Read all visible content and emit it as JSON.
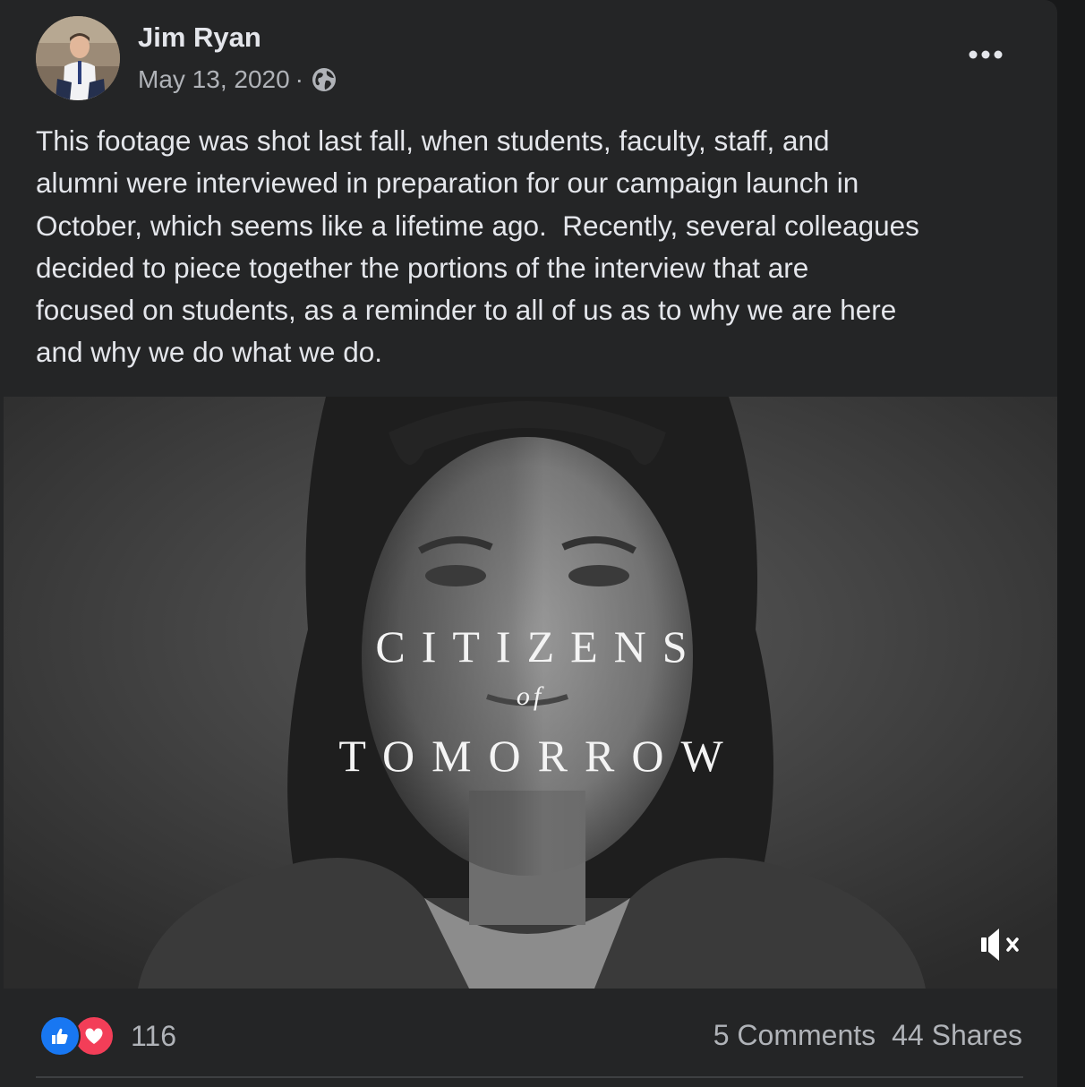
{
  "post": {
    "author": "Jim Ryan",
    "date": "May 13, 2020",
    "separator": "·",
    "audience_icon": "globe-icon",
    "more_icon": "more-options-icon",
    "message": "This footage was shot last fall, when students, faculty, staff, and\nalumni were interviewed in preparation for our campaign launch in\nOctober, which seems like a lifetime ago.  Recently, several colleagues\ndecided to piece together the portions of the interview that are\nfocused on students, as a reminder to all of us as to why we are here\nand why we do what we do."
  },
  "video": {
    "title_top": "CITIZENS",
    "title_of": "of",
    "title_bottom": "TOMORROW",
    "muted": true,
    "mute_icon": "speaker-muted-icon"
  },
  "footer": {
    "reaction_count": "116",
    "comments": "5 Comments",
    "shares": "44 Shares"
  },
  "colors": {
    "background": "#18191a",
    "card": "#242526",
    "primary_text": "#e4e6eb",
    "secondary_text": "#b0b3b8",
    "like_blue": "#1877f2",
    "love_red": "#f33e58"
  }
}
